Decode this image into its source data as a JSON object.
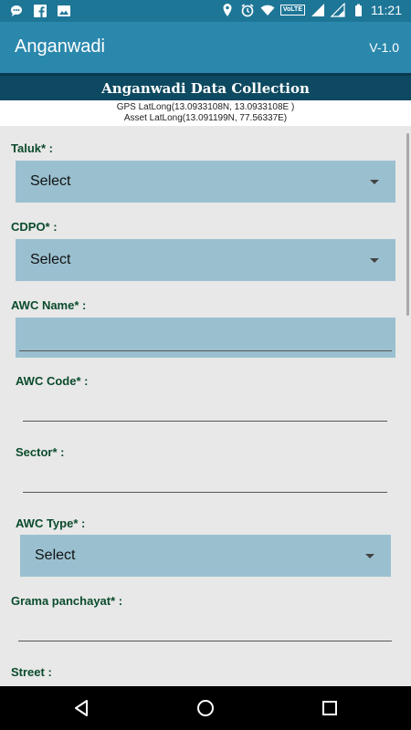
{
  "status_bar": {
    "time": "11:21",
    "volte": "VoLTE",
    "icons": [
      "chat-bubble-icon",
      "facebook-icon",
      "image-icon",
      "location-icon",
      "alarm-icon",
      "wifi-icon",
      "signal-icon",
      "signal-icon",
      "battery-icon"
    ]
  },
  "app_bar": {
    "title": "Anganwadi",
    "version": "V-1.0"
  },
  "banner": {
    "title": "Anganwadi Data Collection"
  },
  "coords": {
    "gps": "GPS LatLong(13.0933108N, 13.0933108E )",
    "asset": "Asset LatLong(13.091199N, 77.56337E)"
  },
  "form": {
    "taluk_label": "Taluk*  :",
    "taluk_value": "Select",
    "cdpo_label": "CDPO*  :",
    "cdpo_value": "Select",
    "awc_name_label": "AWC Name*  :",
    "awc_name_value": "",
    "awc_code_label": "AWC Code*  :",
    "awc_code_value": "",
    "sector_label": "Sector*  :",
    "sector_value": "",
    "awc_type_label": "AWC Type*  :",
    "awc_type_value": "Select",
    "grama_label": "Grama panchayat* :",
    "grama_value": "",
    "street_label": "Street :"
  },
  "colors": {
    "status_bar": "#1e7697",
    "app_bar": "#2b88ad",
    "banner": "#0d4960",
    "select_bg": "#9ac0d0",
    "label": "#0b4b2c"
  }
}
